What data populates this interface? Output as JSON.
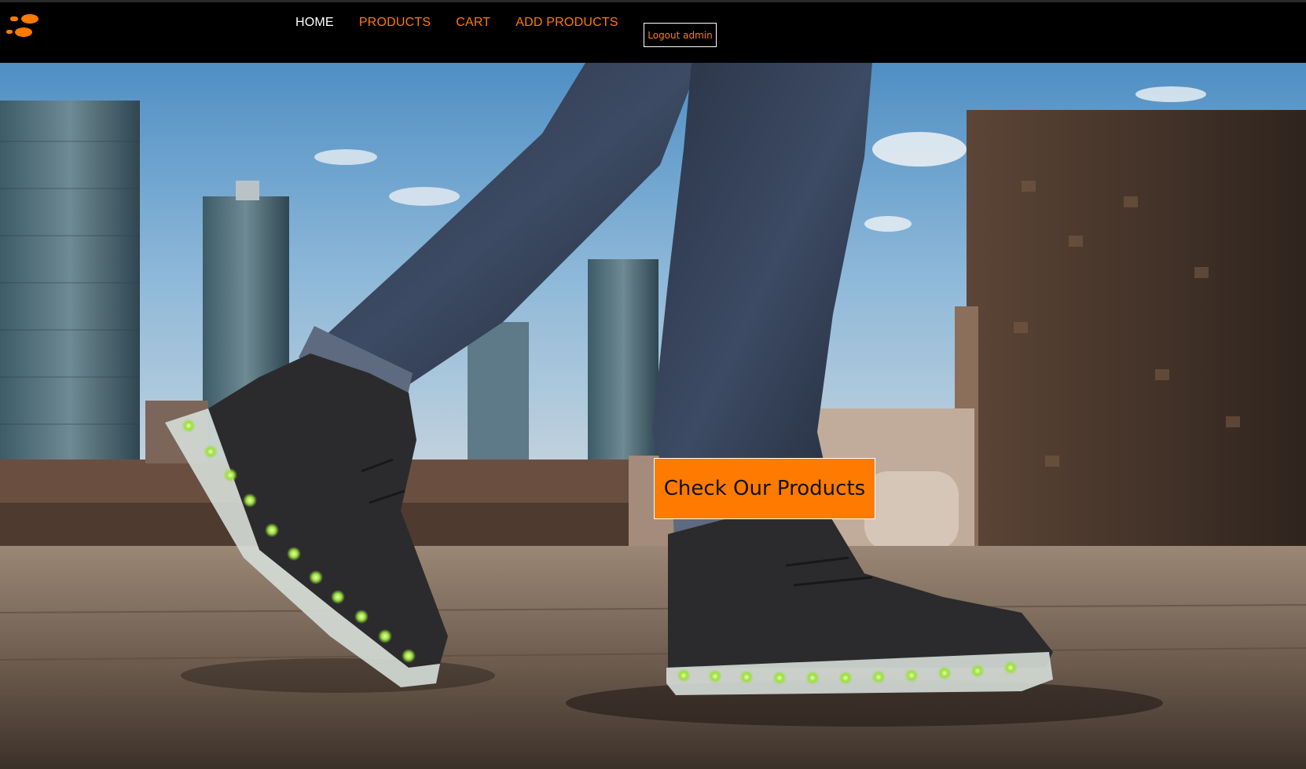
{
  "header": {
    "logo_icon": "footprints-icon",
    "nav": [
      {
        "label": "HOME",
        "active": true
      },
      {
        "label": "PRODUCTS",
        "active": false
      },
      {
        "label": "CART",
        "active": false
      },
      {
        "label": "ADD PRODUCTS",
        "active": false
      }
    ],
    "logout_label": "Logout admin"
  },
  "hero": {
    "image_subject": "hero-sneakers-photo",
    "cta_label": "Check Our Products"
  },
  "colors": {
    "accent": "#ff7a00",
    "nav_bg": "#000000",
    "active_nav": "#ffffff"
  }
}
